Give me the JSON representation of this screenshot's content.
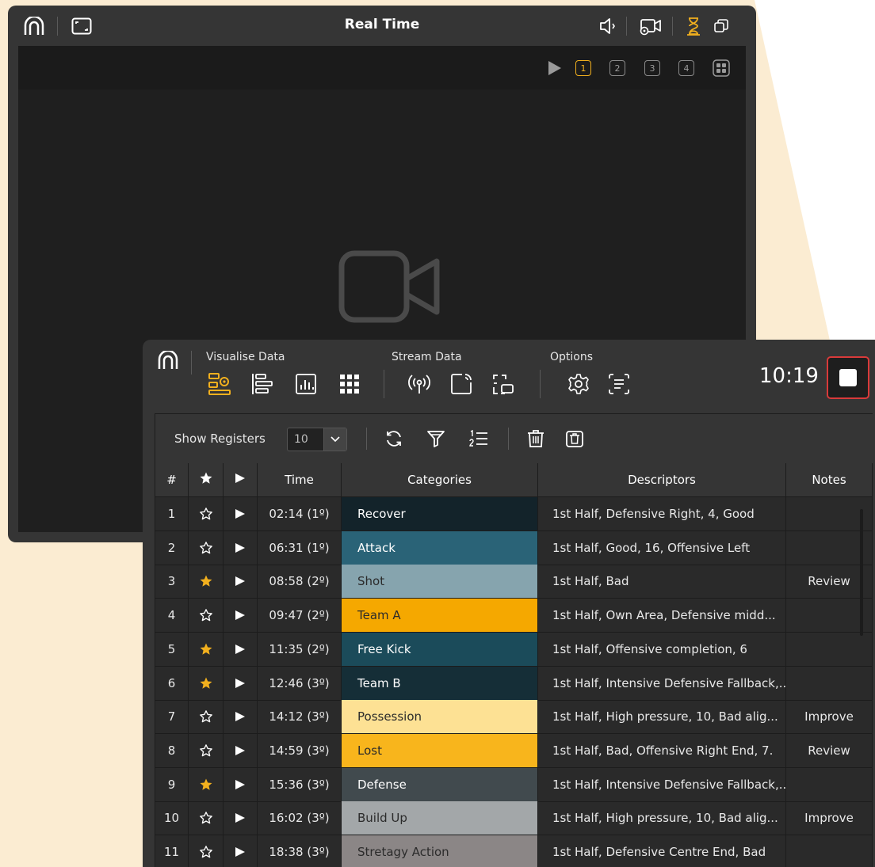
{
  "colors": {
    "accent": "#f2b01e",
    "window_bg": "#353535",
    "stop_border": "#d93a3a"
  },
  "realtime_window": {
    "title": "Real Time",
    "camera_buttons": [
      "1",
      "2",
      "3",
      "4"
    ],
    "active_camera": "1",
    "icons": [
      "logo-icon",
      "fullscreen-icon",
      "speaker-icon",
      "camera-settings-icon",
      "hourglass-icon",
      "restore-window-icon",
      "play-icon",
      "grid-icon",
      "video-camera-icon"
    ]
  },
  "data_panel": {
    "groups": {
      "visualise": "Visualise Data",
      "stream": "Stream Data",
      "options": "Options"
    },
    "clock": "10:19",
    "show_registers_label": "Show Registers",
    "registers_value": "10",
    "columns": {
      "num": "#",
      "time": "Time",
      "categories": "Categories",
      "descriptors": "Descriptors",
      "notes": "Notes"
    },
    "rows": [
      {
        "n": "1",
        "starred": false,
        "time": "02:14 (1º)",
        "category": "Recover",
        "cat_color": "#13232a",
        "cat_text": "#ffffff",
        "descriptors": "1st Half, Defensive Right, 4, Good",
        "note": ""
      },
      {
        "n": "2",
        "starred": false,
        "time": "06:31 (1º)",
        "category": "Attack",
        "cat_color": "#2a6377",
        "cat_text": "#ffffff",
        "descriptors": "1st Half, Good, 16, Offensive Left",
        "note": ""
      },
      {
        "n": "3",
        "starred": true,
        "time": "08:58 (2º)",
        "category": "Shot",
        "cat_color": "#86a4ae",
        "cat_text": "#2b2b2b",
        "descriptors": "1st Half, Bad",
        "note": "Review"
      },
      {
        "n": "4",
        "starred": false,
        "time": "09:47 (2º)",
        "category": "Team A",
        "cat_color": "#f5a800",
        "cat_text": "#2b2b2b",
        "descriptors": "1st Half, Own Area, Defensive midd...",
        "note": ""
      },
      {
        "n": "5",
        "starred": true,
        "time": "11:35 (2º)",
        "category": "Free Kick",
        "cat_color": "#1b4b5a",
        "cat_text": "#ffffff",
        "descriptors": "1st Half, Offensive completion, 6",
        "note": ""
      },
      {
        "n": "6",
        "starred": true,
        "time": "12:46 (3º)",
        "category": "Team B",
        "cat_color": "#152e37",
        "cat_text": "#ffffff",
        "descriptors": "1st Half, Intensive Defensive Fallback,...",
        "note": ""
      },
      {
        "n": "7",
        "starred": false,
        "time": "14:12 (3º)",
        "category": "Possession",
        "cat_color": "#fde194",
        "cat_text": "#2b2b2b",
        "descriptors": "1st Half, High pressure, 10, Bad alig...",
        "note": "Improve"
      },
      {
        "n": "8",
        "starred": false,
        "time": "14:59 (3º)",
        "category": "Lost",
        "cat_color": "#f8b51c",
        "cat_text": "#2b2b2b",
        "descriptors": "1st Half, Bad, Offensive Right End, 7.",
        "note": "Review"
      },
      {
        "n": "9",
        "starred": true,
        "time": "15:36 (3º)",
        "category": "Defense",
        "cat_color": "#414a4e",
        "cat_text": "#ffffff",
        "descriptors": "1st Half, Intensive Defensive Fallback,...",
        "note": ""
      },
      {
        "n": "10",
        "starred": false,
        "time": "16:02 (3º)",
        "category": "Build Up",
        "cat_color": "#a3a7a9",
        "cat_text": "#2b2b2b",
        "descriptors": "1st Half, High pressure, 10, Bad alig...",
        "note": "Improve"
      },
      {
        "n": "11",
        "starred": false,
        "time": "18:38 (3º)",
        "category": "Stretagy Action",
        "cat_color": "#8b8686",
        "cat_text": "#2b2b2b",
        "descriptors": "1st Half, Defensive Centre End, Bad",
        "note": ""
      }
    ]
  }
}
